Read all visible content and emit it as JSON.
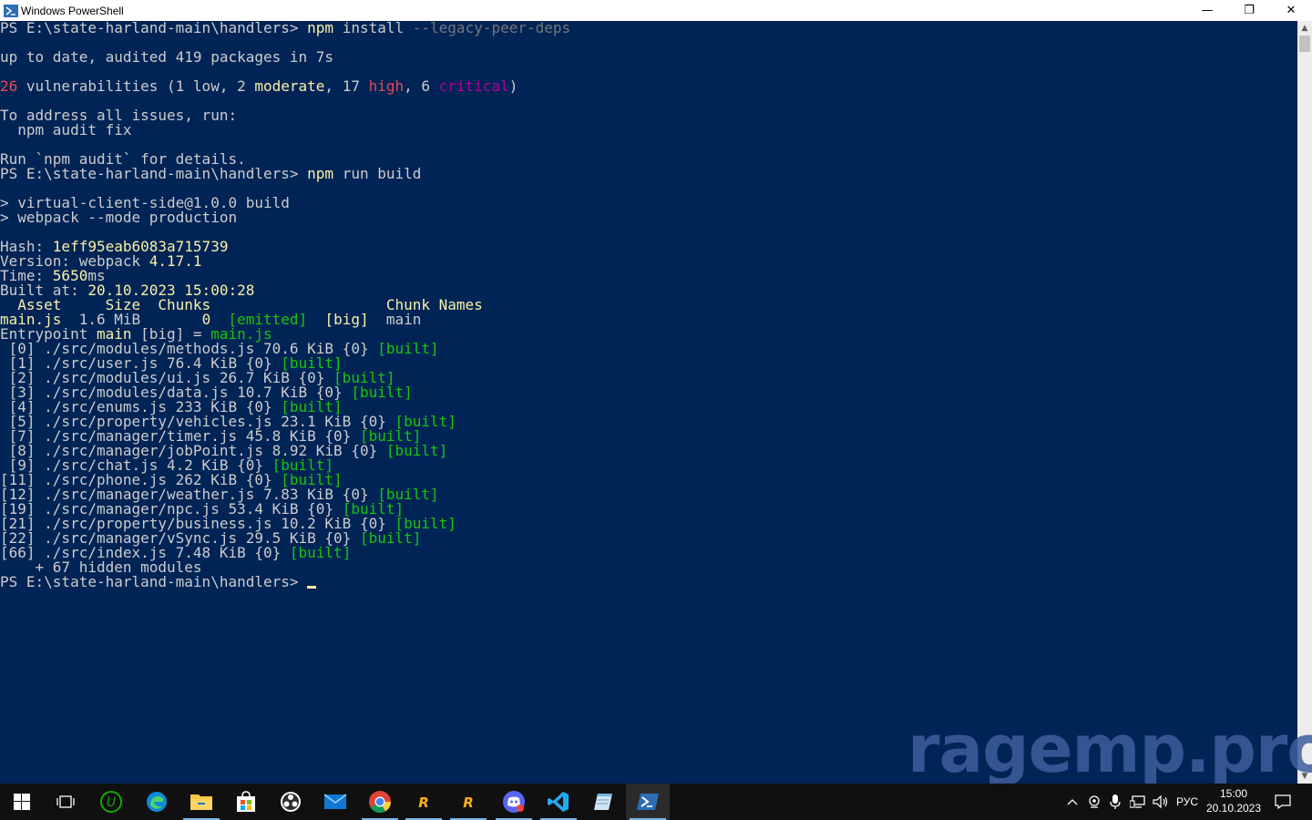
{
  "window": {
    "title": "Windows PowerShell",
    "minimize_glyph": "—",
    "maximize_glyph": "❐",
    "close_glyph": "✕"
  },
  "console": {
    "lines": [
      {
        "segments": [
          {
            "text": "PS E:\\state-harland-main\\handlers> ",
            "color": "default"
          },
          {
            "text": "npm",
            "color": "yellow"
          },
          {
            "text": " install ",
            "color": "default"
          },
          {
            "text": "--legacy-peer-deps",
            "color": "gray"
          }
        ]
      },
      {
        "segments": []
      },
      {
        "segments": [
          {
            "text": "up to date, audited 419 packages in 7s",
            "color": "default"
          }
        ]
      },
      {
        "segments": []
      },
      {
        "segments": [
          {
            "text": "26",
            "color": "red"
          },
          {
            "text": " vulnerabilities (1 ",
            "color": "default"
          },
          {
            "text": "low",
            "color": "default"
          },
          {
            "text": ", 2 ",
            "color": "default"
          },
          {
            "text": "moderate",
            "color": "yellow"
          },
          {
            "text": ", 17 ",
            "color": "default"
          },
          {
            "text": "high",
            "color": "red"
          },
          {
            "text": ", 6 ",
            "color": "default"
          },
          {
            "text": "critical",
            "color": "magenta"
          },
          {
            "text": ")",
            "color": "default"
          }
        ]
      },
      {
        "segments": []
      },
      {
        "segments": [
          {
            "text": "To address all issues, run:",
            "color": "default"
          }
        ]
      },
      {
        "segments": [
          {
            "text": "  npm audit fix",
            "color": "default"
          }
        ]
      },
      {
        "segments": []
      },
      {
        "segments": [
          {
            "text": "Run `npm audit` for details.",
            "color": "default"
          }
        ]
      },
      {
        "segments": [
          {
            "text": "PS E:\\state-harland-main\\handlers> ",
            "color": "default"
          },
          {
            "text": "npm",
            "color": "yellow"
          },
          {
            "text": " run build",
            "color": "default"
          }
        ]
      },
      {
        "segments": []
      },
      {
        "segments": [
          {
            "text": "> virtual-client-side@1.0.0 build",
            "color": "default"
          }
        ]
      },
      {
        "segments": [
          {
            "text": "> webpack --mode production",
            "color": "default"
          }
        ]
      },
      {
        "segments": []
      },
      {
        "segments": [
          {
            "text": "Hash: ",
            "color": "default"
          },
          {
            "text": "1eff95eab6083a715739",
            "color": "yellow"
          }
        ]
      },
      {
        "segments": [
          {
            "text": "Version: webpack ",
            "color": "default"
          },
          {
            "text": "4.17.1",
            "color": "yellow"
          }
        ]
      },
      {
        "segments": [
          {
            "text": "Time: ",
            "color": "default"
          },
          {
            "text": "5650",
            "color": "yellow"
          },
          {
            "text": "ms",
            "color": "default"
          }
        ]
      },
      {
        "segments": [
          {
            "text": "Built at: ",
            "color": "default"
          },
          {
            "text": "20.10.2023 15:00:28",
            "color": "yellow"
          }
        ]
      },
      {
        "segments": [
          {
            "text": "  Asset     Size  Chunks                    Chunk Names",
            "color": "yellow"
          }
        ]
      },
      {
        "segments": [
          {
            "text": "main.js",
            "color": "yellow"
          },
          {
            "text": "  1.6 MiB       ",
            "color": "default"
          },
          {
            "text": "0",
            "color": "yellow"
          },
          {
            "text": "  ",
            "color": "default"
          },
          {
            "text": "[emitted]",
            "color": "green"
          },
          {
            "text": "  ",
            "color": "default"
          },
          {
            "text": "[big]",
            "color": "yellow"
          },
          {
            "text": "  main",
            "color": "default"
          }
        ]
      },
      {
        "segments": [
          {
            "text": "Entrypoint ",
            "color": "default"
          },
          {
            "text": "main",
            "color": "yellow"
          },
          {
            "text": " [big] = ",
            "color": "default"
          },
          {
            "text": "main.js",
            "color": "green"
          }
        ]
      },
      {
        "segments": [
          {
            "text": " [0] ./src/modules/methods.js 70.6 KiB {0} ",
            "color": "default"
          },
          {
            "text": "[built]",
            "color": "green"
          }
        ]
      },
      {
        "segments": [
          {
            "text": " [1] ./src/user.js 76.4 KiB {0} ",
            "color": "default"
          },
          {
            "text": "[built]",
            "color": "green"
          }
        ]
      },
      {
        "segments": [
          {
            "text": " [2] ./src/modules/ui.js 26.7 KiB {0} ",
            "color": "default"
          },
          {
            "text": "[built]",
            "color": "green"
          }
        ]
      },
      {
        "segments": [
          {
            "text": " [3] ./src/modules/data.js 10.7 KiB {0} ",
            "color": "default"
          },
          {
            "text": "[built]",
            "color": "green"
          }
        ]
      },
      {
        "segments": [
          {
            "text": " [4] ./src/enums.js 233 KiB {0} ",
            "color": "default"
          },
          {
            "text": "[built]",
            "color": "green"
          }
        ]
      },
      {
        "segments": [
          {
            "text": " [5] ./src/property/vehicles.js 23.1 KiB {0} ",
            "color": "default"
          },
          {
            "text": "[built]",
            "color": "green"
          }
        ]
      },
      {
        "segments": [
          {
            "text": " [7] ./src/manager/timer.js 45.8 KiB {0} ",
            "color": "default"
          },
          {
            "text": "[built]",
            "color": "green"
          }
        ]
      },
      {
        "segments": [
          {
            "text": " [8] ./src/manager/jobPoint.js 8.92 KiB {0} ",
            "color": "default"
          },
          {
            "text": "[built]",
            "color": "green"
          }
        ]
      },
      {
        "segments": [
          {
            "text": " [9] ./src/chat.js 4.2 KiB {0} ",
            "color": "default"
          },
          {
            "text": "[built]",
            "color": "green"
          }
        ]
      },
      {
        "segments": [
          {
            "text": "[11] ./src/phone.js 262 KiB {0} ",
            "color": "default"
          },
          {
            "text": "[built]",
            "color": "green"
          }
        ]
      },
      {
        "segments": [
          {
            "text": "[12] ./src/manager/weather.js 7.83 KiB {0} ",
            "color": "default"
          },
          {
            "text": "[built]",
            "color": "green"
          }
        ]
      },
      {
        "segments": [
          {
            "text": "[19] ./src/manager/npc.js 53.4 KiB {0} ",
            "color": "default"
          },
          {
            "text": "[built]",
            "color": "green"
          }
        ]
      },
      {
        "segments": [
          {
            "text": "[21] ./src/property/business.js 10.2 KiB {0} ",
            "color": "default"
          },
          {
            "text": "[built]",
            "color": "green"
          }
        ]
      },
      {
        "segments": [
          {
            "text": "[22] ./src/manager/vSync.js 29.5 KiB {0} ",
            "color": "default"
          },
          {
            "text": "[built]",
            "color": "green"
          }
        ]
      },
      {
        "segments": [
          {
            "text": "[66] ./src/index.js 7.48 KiB {0} ",
            "color": "default"
          },
          {
            "text": "[built]",
            "color": "green"
          }
        ]
      },
      {
        "segments": [
          {
            "text": "    + 67 hidden modules",
            "color": "default"
          }
        ]
      },
      {
        "segments": [
          {
            "text": "PS E:\\state-harland-main\\handlers> ",
            "color": "default"
          }
        ],
        "cursor": true
      }
    ]
  },
  "watermark": "ragemp.pro",
  "taskbar": {
    "apps": [
      {
        "name": "start-button",
        "icon": "windows-logo-icon",
        "active": false
      },
      {
        "name": "task-view-button",
        "icon": "task-view-icon",
        "active": false
      },
      {
        "name": "taskbar-app-upwork",
        "icon": "upwork-icon",
        "active": false
      },
      {
        "name": "taskbar-app-edge",
        "icon": "edge-icon",
        "active": false
      },
      {
        "name": "taskbar-app-explorer",
        "icon": "folder-icon",
        "active": false
      },
      {
        "name": "taskbar-app-store",
        "icon": "store-icon",
        "active": false
      },
      {
        "name": "taskbar-app-obs",
        "icon": "obs-icon",
        "active": false
      },
      {
        "name": "taskbar-app-mail",
        "icon": "mail-icon",
        "active": false
      },
      {
        "name": "taskbar-app-chrome",
        "icon": "chrome-icon",
        "active": false
      },
      {
        "name": "taskbar-app-rockstar-1",
        "icon": "rockstar-icon",
        "active": false
      },
      {
        "name": "taskbar-app-rockstar-2",
        "icon": "rockstar-icon",
        "active": false
      },
      {
        "name": "taskbar-app-discord",
        "icon": "discord-icon",
        "active": false
      },
      {
        "name": "taskbar-app-vscode",
        "icon": "vscode-icon",
        "active": false
      },
      {
        "name": "taskbar-app-notepad",
        "icon": "notepad-icon",
        "active": false
      },
      {
        "name": "taskbar-app-powershell",
        "icon": "powershell-icon",
        "active": true
      }
    ],
    "tray": {
      "language": "РУС",
      "time": "15:00",
      "date": "20.10.2023"
    }
  },
  "colors": {
    "console_bg": "#012456",
    "default": "#cccccc",
    "yellow": "#f9f1a5",
    "gray": "#767676",
    "red": "#e74856",
    "magenta": "#b4009e",
    "green": "#16c60c",
    "taskbar_accent": "#76b9ed"
  }
}
